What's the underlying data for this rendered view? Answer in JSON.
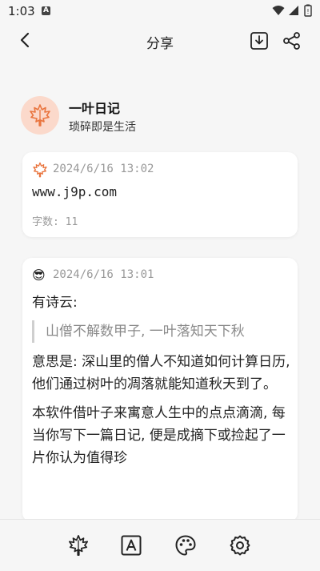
{
  "status_bar": {
    "time": "1:03",
    "a_badge": "A"
  },
  "header": {
    "title": "分享"
  },
  "profile": {
    "name": "一叶日记",
    "subtitle": "琐碎即是生活"
  },
  "entries": [
    {
      "date": "2024/6/16 13:02",
      "text": "www.j9p.com",
      "word_count": "字数: 11"
    },
    {
      "date": "2024/6/16 13:01",
      "emoji": "😎",
      "line1": "有诗云:",
      "quote": "山僧不解数甲子, 一叶落知天下秋",
      "para2": "意思是: 深山里的僧人不知道如何计算日历, 他们通过树叶的凋落就能知道秋天到了。",
      "para3": "本软件借叶子来寓意人生中的点点滴滴, 每当你写下一篇日记, 便是成摘下或捡起了一片你认为值得珍"
    }
  ],
  "colors": {
    "accent": "#e9753f",
    "avatar_bg": "#fbd9cb",
    "background": "#f6f6f6"
  }
}
